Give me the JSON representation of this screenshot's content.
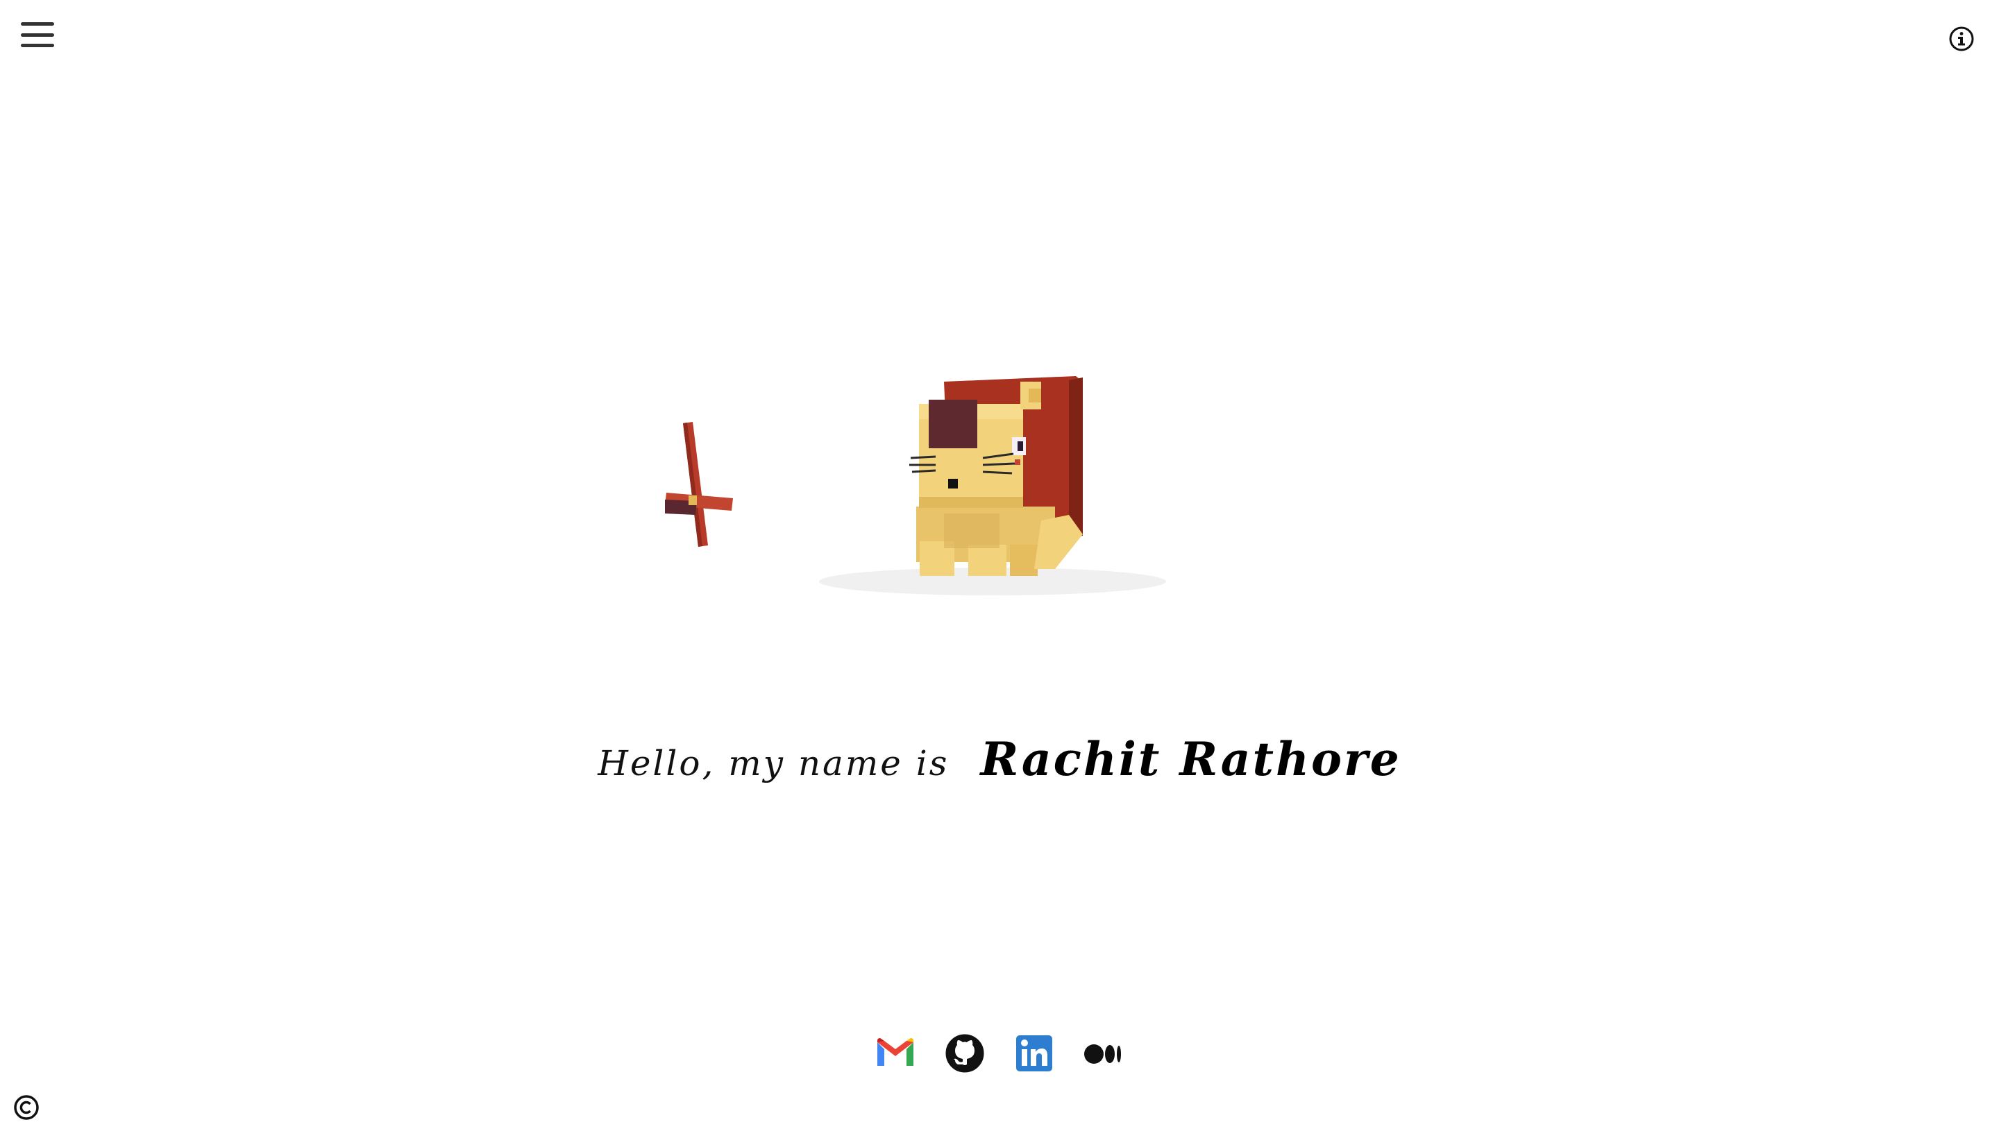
{
  "header": {
    "menu_icon": "hamburger-menu-icon",
    "info_icon": "info-icon"
  },
  "hero": {
    "illustration": "voxel-lion-with-windmill",
    "colors": {
      "mane": "#a8321f",
      "body": "#f2d27a",
      "windmill": "#b83a28"
    }
  },
  "greeting": {
    "intro": "Hello, my name is",
    "name": "Rachit Rathore"
  },
  "social_links": [
    {
      "icon": "gmail-icon"
    },
    {
      "icon": "github-icon"
    },
    {
      "icon": "linkedin-icon"
    },
    {
      "icon": "medium-icon"
    }
  ],
  "footer": {
    "copyright_icon": "copyright-icon"
  }
}
